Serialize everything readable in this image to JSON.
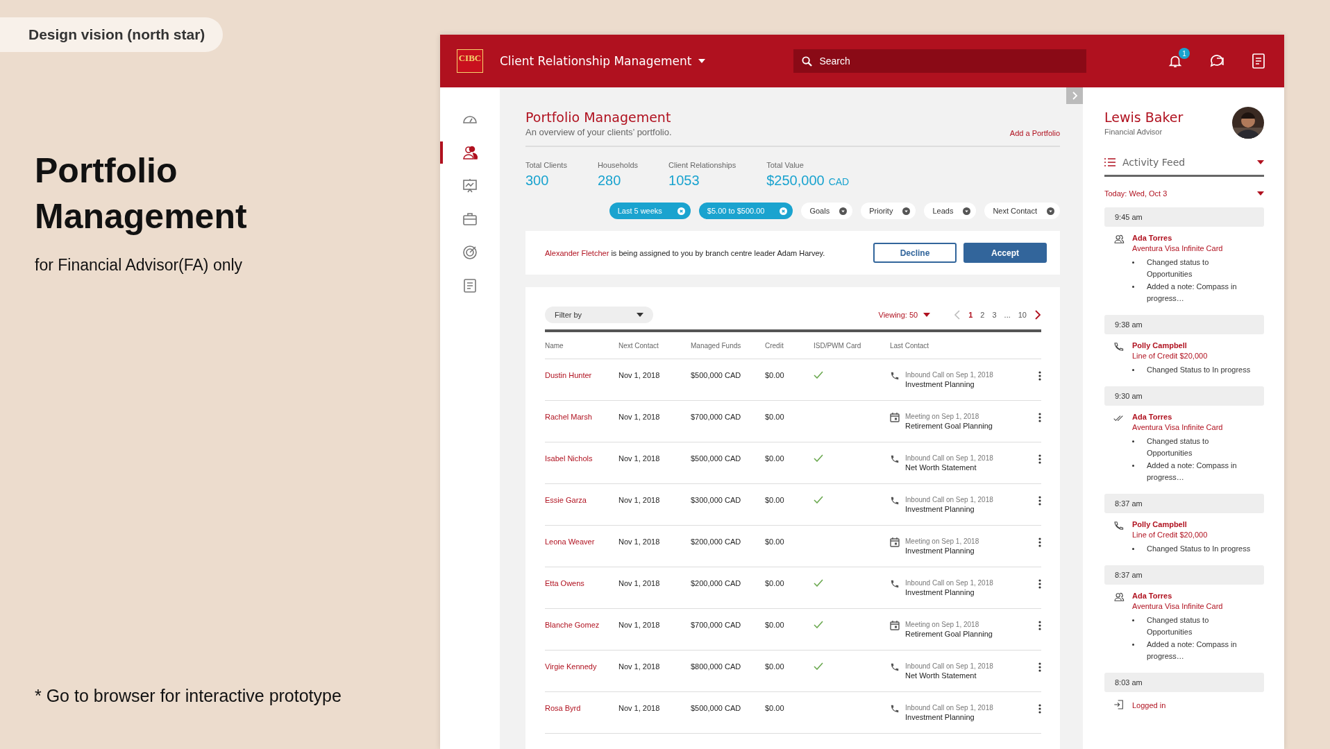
{
  "slide": {
    "tag": "Design vision (north star)",
    "title": "Portfolio Management",
    "subtitle": "for Financial Advisor(FA) only",
    "footnote": "* Go to browser for interactive prototype"
  },
  "header": {
    "logo": "CIBC",
    "title": "Client Relationship Management",
    "search": {
      "placeholder": "Search"
    },
    "notification_count": "1"
  },
  "nav": [
    {
      "kind": "dashboard",
      "selected": false
    },
    {
      "kind": "clients",
      "selected": true
    },
    {
      "kind": "presentation",
      "selected": false
    },
    {
      "kind": "briefcase",
      "selected": false
    },
    {
      "kind": "target",
      "selected": false
    },
    {
      "kind": "document",
      "selected": false
    }
  ],
  "page": {
    "title": "Portfolio Management",
    "subtitle": "An overview of your clients’ portfolio.",
    "action": "Add a Portfolio"
  },
  "stats": [
    {
      "label": "Total Clients",
      "value": "300"
    },
    {
      "label": "Households",
      "value": "280"
    },
    {
      "label": "Client Relationships",
      "value": "1053"
    },
    {
      "label": "Total Value",
      "value": "$250,000",
      "unit": "CAD"
    }
  ],
  "chips": [
    {
      "label": "Last 5 weeks",
      "selected": true
    },
    {
      "label": "$5.00 to $500.00",
      "selected": true
    },
    {
      "label": "Goals",
      "selected": false
    },
    {
      "label": "Priority",
      "selected": false
    },
    {
      "label": "Leads",
      "selected": false
    },
    {
      "label": "Next Contact",
      "selected": false
    }
  ],
  "notice": {
    "name": "Alexander Fletcher",
    "text": "is being assigned to you by branch centre leader Adam Harvey.",
    "buttons": [
      {
        "label": "Decline",
        "kind": "secondary"
      },
      {
        "label": "Accept",
        "kind": "primary"
      }
    ]
  },
  "table": {
    "filter": "Filter by",
    "viewing": "Viewing: 50",
    "pages": [
      {
        "label": "1",
        "selected": true
      },
      {
        "label": "2",
        "selected": false
      },
      {
        "label": "3",
        "selected": false
      },
      {
        "label": "...",
        "selected": false
      },
      {
        "label": "10",
        "selected": false
      }
    ],
    "columns": [
      "Name",
      "Next Contact",
      "Managed Funds",
      "Credit",
      "ISD/PWM Card",
      "Last Contact"
    ],
    "rows": [
      {
        "name": "Dustin Hunter",
        "next": "Nov 1, 2018",
        "funds": "$500,000 CAD",
        "credit": "$0.00",
        "card": true,
        "kind": "call",
        "contact": "Inbound Call on Sep 1, 2018",
        "topic": "Investment Planning"
      },
      {
        "name": "Rachel Marsh",
        "next": "Nov 1, 2018",
        "funds": "$700,000 CAD",
        "credit": "$0.00",
        "card": false,
        "kind": "meeting",
        "contact": "Meeting on Sep 1, 2018",
        "topic": "Retirement Goal Planning"
      },
      {
        "name": "Isabel Nichols",
        "next": "Nov 1, 2018",
        "funds": "$500,000 CAD",
        "credit": "$0.00",
        "card": true,
        "kind": "call",
        "contact": "Inbound Call on Sep 1, 2018",
        "topic": "Net Worth Statement"
      },
      {
        "name": "Essie Garza",
        "next": "Nov 1, 2018",
        "funds": "$300,000 CAD",
        "credit": "$0.00",
        "card": true,
        "kind": "call",
        "contact": "Inbound Call on Sep 1, 2018",
        "topic": "Investment Planning"
      },
      {
        "name": "Leona Weaver",
        "next": "Nov 1, 2018",
        "funds": "$200,000 CAD",
        "credit": "$0.00",
        "card": false,
        "kind": "meeting",
        "contact": "Meeting on Sep 1, 2018",
        "topic": "Investment Planning"
      },
      {
        "name": "Etta Owens",
        "next": "Nov 1, 2018",
        "funds": "$200,000 CAD",
        "credit": "$0.00",
        "card": true,
        "kind": "call",
        "contact": "Inbound Call on Sep 1, 2018",
        "topic": "Investment Planning"
      },
      {
        "name": "Blanche Gomez",
        "next": "Nov 1, 2018",
        "funds": "$700,000 CAD",
        "credit": "$0.00",
        "card": true,
        "kind": "meeting",
        "contact": "Meeting on Sep 1, 2018",
        "topic": "Retirement Goal Planning"
      },
      {
        "name": "Virgie Kennedy",
        "next": "Nov 1, 2018",
        "funds": "$800,000 CAD",
        "credit": "$0.00",
        "card": true,
        "kind": "call",
        "contact": "Inbound Call on Sep 1, 2018",
        "topic": "Net Worth Statement"
      },
      {
        "name": "Rosa Byrd",
        "next": "Nov 1, 2018",
        "funds": "$500,000 CAD",
        "credit": "$0.00",
        "card": false,
        "kind": "call",
        "contact": "Inbound Call on Sep 1, 2018",
        "topic": "Investment Planning"
      }
    ]
  },
  "profile": {
    "name": "Lewis Baker",
    "role": "Financial Advisor"
  },
  "feed": {
    "title": "Activity Feed",
    "date": "Today: Wed, Oct 3",
    "items": [
      {
        "time": "9:45 am",
        "kind": "person",
        "name": "Ada Torres",
        "detail": "Aventura Visa Infinite Card",
        "bullets": [
          "Changed status to Opportunities",
          "Added a note: Compass in progress…"
        ]
      },
      {
        "time": "9:38 am",
        "kind": "call",
        "name": "Polly Campbell",
        "detail": "Line of Credit $20,000",
        "bullets": [
          "Changed Status to In progress"
        ]
      },
      {
        "time": "9:30 am",
        "kind": "done",
        "name": "Ada Torres",
        "detail": "Aventura Visa Infinite Card",
        "bullets": [
          "Changed status to Opportunities",
          "Added a note: Compass in progress…"
        ]
      },
      {
        "time": "8:37 am",
        "kind": "call",
        "name": "Polly Campbell",
        "detail": "Line of Credit $20,000",
        "bullets": [
          "Changed Status to In progress"
        ]
      },
      {
        "time": "8:37 am",
        "kind": "person",
        "name": "Ada Torres",
        "detail": "Aventura Visa Infinite Card",
        "bullets": [
          "Changed status to Opportunities",
          "Added a note: Compass in progress…"
        ]
      },
      {
        "time": "8:03 am",
        "kind": "login",
        "detail": "Logged in"
      }
    ]
  }
}
